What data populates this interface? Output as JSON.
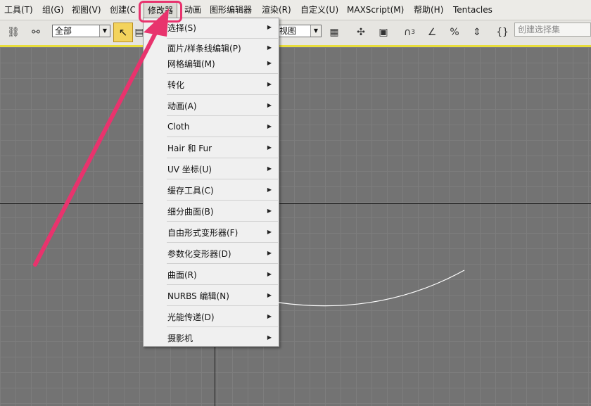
{
  "menubar": {
    "items": [
      "工具(T)",
      "组(G)",
      "视图(V)",
      "创建(C)",
      "修改器",
      "动画",
      "图形编辑器",
      "渲染(R)",
      "自定义(U)",
      "MAXScript(M)",
      "帮助(H)",
      "Tentacles"
    ]
  },
  "toolbar": {
    "selection_filter": "全部",
    "coord_system": "视图",
    "named_selection_placeholder": "创建选择集",
    "snap_angle_label": "3"
  },
  "dropdown": {
    "items": [
      "选择(S)",
      "面片/样条线编辑(P)",
      "网格编辑(M)",
      "转化",
      "动画(A)",
      "Cloth",
      "Hair 和 Fur",
      "UV 坐标(U)",
      "缓存工具(C)",
      "细分曲面(B)",
      "自由形式变形器(F)",
      "参数化变形器(D)",
      "曲面(R)",
      "NURBS 编辑(N)",
      "光能传递(D)",
      "摄影机"
    ]
  },
  "colors": {
    "highlight": "#e8336d",
    "toolbar_accent": "#e8dd3a",
    "viewport_bg": "#737373",
    "curve": "#ffffff"
  }
}
